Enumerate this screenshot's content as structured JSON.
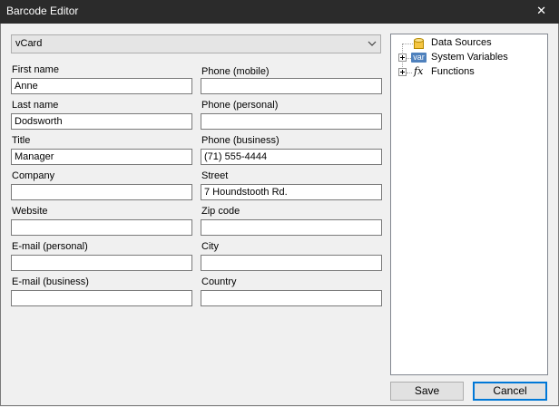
{
  "window": {
    "title": "Barcode Editor",
    "close_glyph": "✕"
  },
  "barcode_type": {
    "selected": "vCard"
  },
  "left_fields": [
    {
      "label": "First name",
      "value": "Anne"
    },
    {
      "label": "Last name",
      "value": "Dodsworth"
    },
    {
      "label": "Title",
      "value": "Manager"
    },
    {
      "label": "Company",
      "value": ""
    },
    {
      "label": "Website",
      "value": ""
    },
    {
      "label": "E-mail (personal)",
      "value": ""
    },
    {
      "label": "E-mail (business)",
      "value": ""
    }
  ],
  "right_fields": [
    {
      "label": "Phone (mobile)",
      "value": ""
    },
    {
      "label": "Phone (personal)",
      "value": ""
    },
    {
      "label": "Phone (business)",
      "value": "(71) 555-4444"
    },
    {
      "label": "Street",
      "value": "7 Houndstooth Rd."
    },
    {
      "label": "Zip code",
      "value": ""
    },
    {
      "label": "City",
      "value": ""
    },
    {
      "label": "Country",
      "value": ""
    }
  ],
  "tree": {
    "items": [
      {
        "label": "Data Sources",
        "icon": "database-icon"
      },
      {
        "label": "System Variables",
        "icon": "var-icon",
        "icon_text": "var"
      },
      {
        "label": "Functions",
        "icon": "function-icon",
        "icon_text": "fx"
      }
    ]
  },
  "buttons": {
    "save": "Save",
    "cancel": "Cancel"
  },
  "colors": {
    "titlebar": "#2b2b2b",
    "accent": "#0078d7",
    "var_icon": "#4f81bd"
  }
}
